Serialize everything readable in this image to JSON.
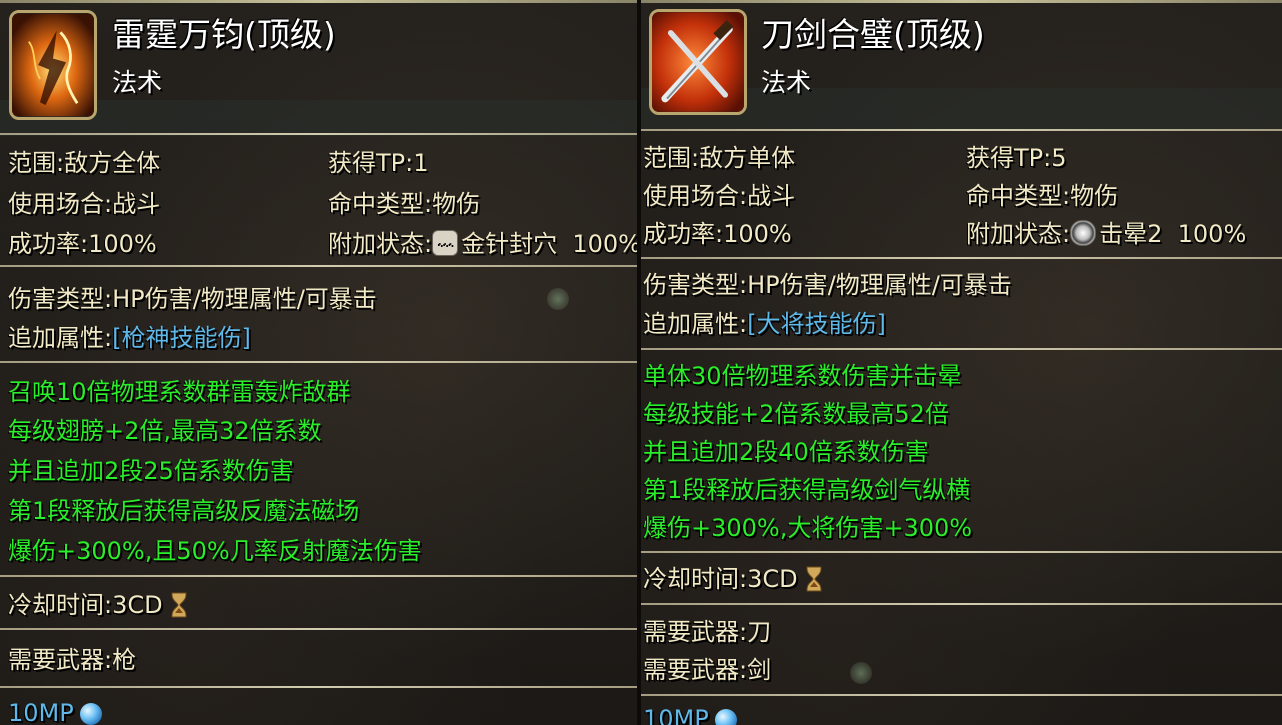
{
  "left": {
    "title": "雷霆万钧(顶级)",
    "category": "法术",
    "range": "范围:敌方全体",
    "tp": "获得TP:1",
    "scene": "使用场合:战斗",
    "hit_type": "命中类型:物伤",
    "success": "成功率:100%",
    "status_label": "附加状态:",
    "status_name": "金针封穴",
    "status_rate": "100%",
    "damage_type": "伤害类型:HP伤害/物理属性/可暴击",
    "extra_label": "追加属性:",
    "extra_value": "[枪神技能伤]",
    "desc": [
      "召唤10倍物理系数群雷轰炸敌群",
      "每级翅膀+2倍,最高32倍系数",
      "并且追加2段25倍系数伤害",
      "第1段释放后获得高级反魔法磁场",
      "爆伤+300%,且50%几率反射魔法伤害"
    ],
    "cooldown": "冷却时间:3CD",
    "weapons": [
      "需要武器:枪"
    ],
    "mp": "10MP",
    "icon": "thunder-figure-icon",
    "status_icon": "speech-bubble-icon"
  },
  "right": {
    "title": "刀剑合璧(顶级)",
    "category": "法术",
    "range": "范围:敌方单体",
    "tp": "获得TP:5",
    "scene": "使用场合:战斗",
    "hit_type": "命中类型:物伤",
    "success": "成功率:100%",
    "status_label": "附加状态:",
    "status_name": "击晕2",
    "status_rate": "100%",
    "damage_type": "伤害类型:HP伤害/物理属性/可暴击",
    "extra_label": "追加属性:",
    "extra_value": "[大将技能伤]",
    "desc": [
      "单体30倍物理系数伤害并击晕",
      "每级技能+2倍系数最高52倍",
      "并且追加2段40倍系数伤害",
      "第1段释放后获得高级剑气纵横",
      "爆伤+300%,大将伤害+300%"
    ],
    "cooldown": "冷却时间:3CD",
    "weapons": [
      "需要武器:刀",
      "需要武器:剑"
    ],
    "mp": "10MP",
    "icon": "crossed-swords-icon",
    "status_icon": "stun-swirl-icon"
  },
  "colors": {
    "label_text": "#f2eac6",
    "extra_attr": "#5fb8e8",
    "description": "#2bee2b",
    "divider": "#d2ccaf"
  }
}
